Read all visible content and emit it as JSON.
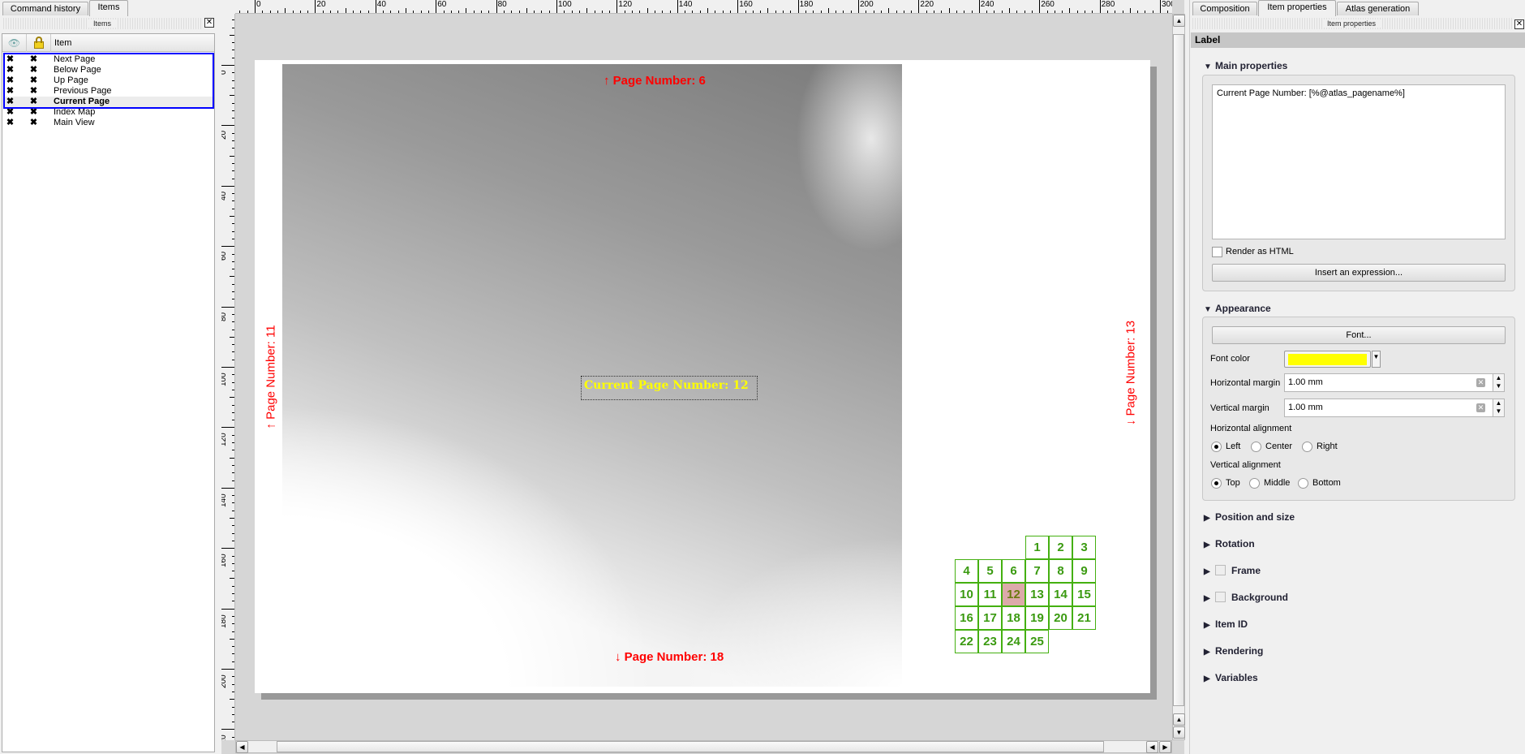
{
  "left_panel": {
    "tabs": [
      "Command history",
      "Items"
    ],
    "active_tab": "Items",
    "dock_title": "Items",
    "columns": {
      "visible_icon": "eye-icon",
      "lock_icon": "lock-icon",
      "item": "Item"
    },
    "items": [
      {
        "name": "Next Page",
        "selected": true
      },
      {
        "name": "Below Page",
        "selected": true
      },
      {
        "name": "Up Page",
        "selected": true
      },
      {
        "name": "Previous Page",
        "selected": true
      },
      {
        "name": "Current Page",
        "selected": true,
        "current": true
      },
      {
        "name": "Index Map",
        "selected": false
      },
      {
        "name": "Main View",
        "selected": false
      }
    ],
    "selection_color": "#0000ff"
  },
  "canvas": {
    "ruler_top_labels": [
      "0",
      "20",
      "40",
      "60",
      "80",
      "100",
      "120",
      "140",
      "160",
      "180",
      "200",
      "220",
      "240",
      "260",
      "280",
      "300"
    ],
    "ruler_left_labels": [
      "0",
      "20",
      "40",
      "60",
      "80",
      "100",
      "120",
      "140",
      "160",
      "180",
      "200",
      "220"
    ],
    "labels": {
      "up": "↑ Page Number: 6",
      "down": "↓ Page Number: 18",
      "previous": "↑ Page Number: 11",
      "next": "↓ Page Number: 13",
      "current": "Current Page Number: 12"
    },
    "label_color": "#ff0000",
    "current_label_color": "#ffff00",
    "index_map": {
      "rows": [
        [
          null,
          null,
          null,
          "1",
          "2",
          "3"
        ],
        [
          "4",
          "5",
          "6",
          "7",
          "8",
          "9"
        ],
        [
          "10",
          "11",
          "12",
          "13",
          "14",
          "15"
        ],
        [
          "16",
          "17",
          "18",
          "19",
          "20",
          "21"
        ],
        [
          "22",
          "23",
          "24",
          "25",
          null,
          null
        ]
      ],
      "current": "12",
      "grid_color": "#44b010",
      "highlight_color": "#dcaaaa"
    }
  },
  "right_panel": {
    "tabs": [
      "Composition",
      "Item properties",
      "Atlas generation"
    ],
    "active_tab": "Item properties",
    "dock_title": "Item properties",
    "item_type": "Label",
    "main_properties": {
      "title": "Main properties",
      "text": "Current Page Number: [%@atlas_pagename%]",
      "render_html_label": "Render as HTML",
      "render_html": false,
      "insert_expression": "Insert an expression..."
    },
    "appearance": {
      "title": "Appearance",
      "font_button": "Font...",
      "font_color_label": "Font color",
      "font_color": "#ffff00",
      "h_margin_label": "Horizontal margin",
      "h_margin": "1.00 mm",
      "v_margin_label": "Vertical margin",
      "v_margin": "1.00 mm",
      "h_align_label": "Horizontal alignment",
      "h_align_options": [
        "Left",
        "Center",
        "Right"
      ],
      "h_align": "Left",
      "v_align_label": "Vertical alignment",
      "v_align_options": [
        "Top",
        "Middle",
        "Bottom"
      ],
      "v_align": "Top"
    },
    "collapsed_sections": [
      "Position and size",
      "Rotation",
      "Frame",
      "Background",
      "Item ID",
      "Rendering",
      "Variables"
    ]
  }
}
